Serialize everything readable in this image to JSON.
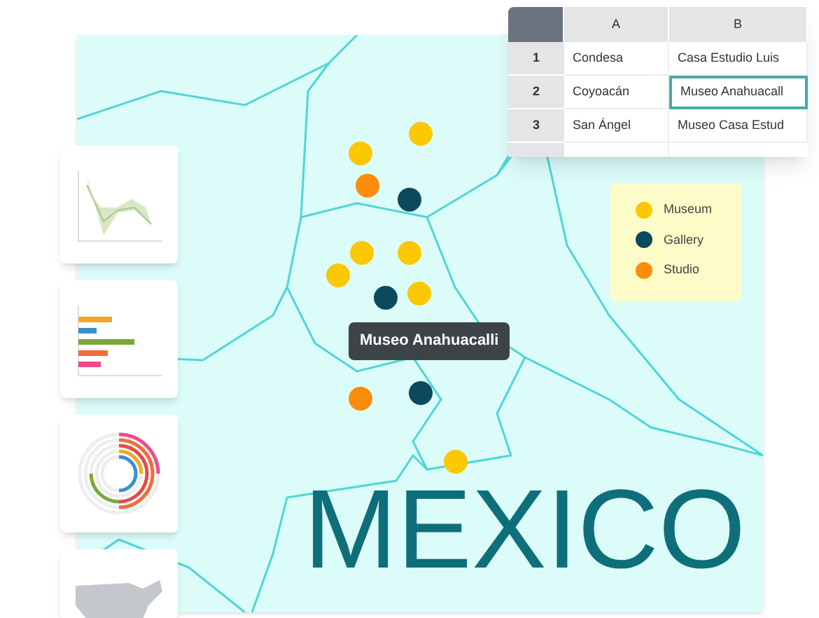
{
  "sheet": {
    "columns": [
      "A",
      "B"
    ],
    "rows": [
      {
        "number": "1",
        "cells": [
          {
            "text": "Condesa",
            "selected": false
          },
          {
            "text": "Casa Estudio Luis",
            "selected": false
          }
        ]
      },
      {
        "number": "2",
        "cells": [
          {
            "text": "Coyoacán",
            "selected": false
          },
          {
            "text": "Museo Anahuacall",
            "selected": true
          }
        ]
      },
      {
        "number": "3",
        "cells": [
          {
            "text": "San Ángel",
            "selected": false
          },
          {
            "text": "Museo Casa Estud",
            "selected": false
          }
        ]
      }
    ]
  },
  "thumbnails": [
    {
      "kind": "line"
    },
    {
      "kind": "bar"
    },
    {
      "kind": "radial"
    },
    {
      "kind": "map"
    }
  ],
  "legend": [
    {
      "label": "Museum",
      "color": "#fcc804"
    },
    {
      "label": "Gallery",
      "color": "#0b4a5e"
    },
    {
      "label": "Studio",
      "color": "#fb8c0c"
    }
  ],
  "markers": [
    {
      "color": "#fcc804"
    },
    {
      "color": "#fcc804"
    },
    {
      "color": "#fb8c0c"
    },
    {
      "color": "#0b4a5e"
    },
    {
      "color": "#fcc804"
    },
    {
      "color": "#fcc804"
    },
    {
      "color": "#fcc804"
    },
    {
      "color": "#0b4a5e"
    },
    {
      "color": "#fcc804"
    },
    {
      "color": "#0b4a5e"
    },
    {
      "color": "#fb8c0c"
    },
    {
      "color": "#fcc804"
    }
  ],
  "tooltip": "Museo Anahuacalli",
  "title": "MEXICO"
}
